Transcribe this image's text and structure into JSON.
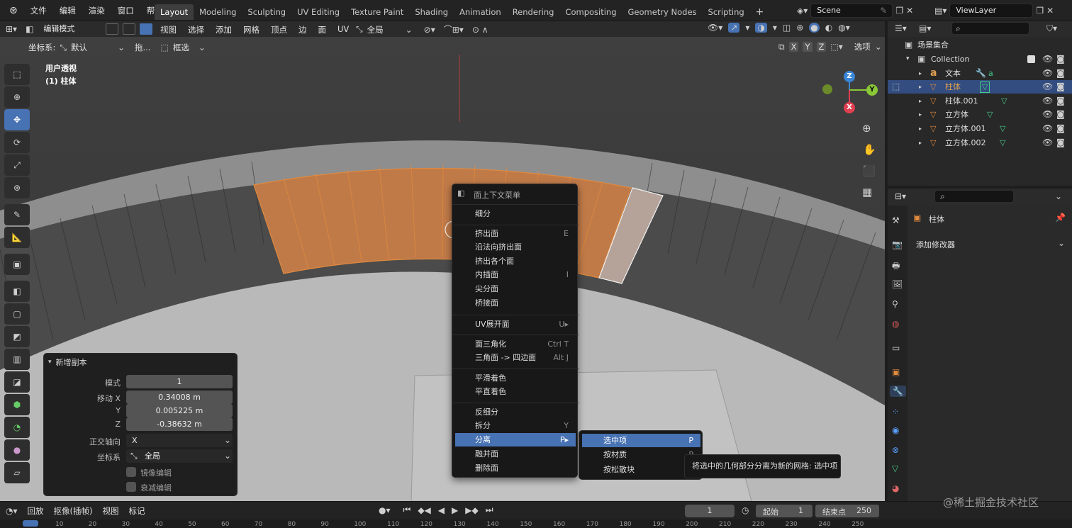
{
  "topbar": {
    "menus": [
      "文件",
      "编辑",
      "渲染",
      "窗口",
      "帮助"
    ],
    "workspaces": [
      "Layout",
      "Modeling",
      "Sculpting",
      "UV Editing",
      "Texture Paint",
      "Shading",
      "Animation",
      "Rendering",
      "Compositing",
      "Geometry Nodes",
      "Scripting"
    ],
    "active_workspace": "Layout",
    "add_icon": "+",
    "scene": "Scene",
    "view_layer": "ViewLayer"
  },
  "viewport_header": {
    "mode": "编辑模式",
    "menus": [
      "视图",
      "选择",
      "添加",
      "网格",
      "顶点",
      "边",
      "面",
      "UV"
    ],
    "transform_orientation": "全局",
    "coord_label": "坐标系:",
    "coord_value": "默认",
    "drag_label": "拖...",
    "drag_value": "框选",
    "axes": [
      "X",
      "Y",
      "Z"
    ],
    "options": "选项"
  },
  "viewport": {
    "view_name": "用户透视",
    "object_name": "(1) 柱体",
    "gizmo": {
      "x": "X",
      "y": "Y",
      "z": "Z"
    }
  },
  "redo_panel": {
    "title": "新增副本",
    "rows": [
      {
        "label": "模式",
        "value": "1"
      },
      {
        "label": "移动 X",
        "value": "0.34008 m"
      },
      {
        "label": "Y",
        "value": "0.005225 m"
      },
      {
        "label": "Z",
        "value": "-0.38632 m"
      },
      {
        "label": "正交轴向",
        "value": "X"
      },
      {
        "label": "坐标系",
        "value": "全局"
      }
    ],
    "checkboxes": [
      "镜像编辑",
      "衰减编辑"
    ]
  },
  "context_menu": {
    "title": "面上下文菜单",
    "groups": [
      [
        {
          "label": "细分",
          "shortcut": ""
        }
      ],
      [
        {
          "label": "挤出面",
          "shortcut": "E"
        },
        {
          "label": "沿法向挤出面",
          "shortcut": ""
        },
        {
          "label": "挤出各个面",
          "shortcut": ""
        },
        {
          "label": "内插面",
          "shortcut": "I"
        },
        {
          "label": "尖分面",
          "shortcut": ""
        },
        {
          "label": "桥接面",
          "shortcut": ""
        }
      ],
      [
        {
          "label": "UV展开面",
          "shortcut": "U▸"
        }
      ],
      [
        {
          "label": "面三角化",
          "shortcut": "Ctrl T"
        },
        {
          "label": "三角面 -> 四边面",
          "shortcut": "Alt J"
        }
      ],
      [
        {
          "label": "平滑着色",
          "shortcut": ""
        },
        {
          "label": "平直着色",
          "shortcut": ""
        }
      ],
      [
        {
          "label": "反细分",
          "shortcut": ""
        },
        {
          "label": "拆分",
          "shortcut": "Y"
        },
        {
          "label": "分离",
          "shortcut": "P▸"
        },
        {
          "label": "融并面",
          "shortcut": ""
        },
        {
          "label": "删除面",
          "shortcut": ""
        }
      ]
    ],
    "highlighted": "分离"
  },
  "submenu": {
    "items": [
      {
        "label": "选中项",
        "shortcut": "P"
      },
      {
        "label": "按材质",
        "shortcut": "P"
      },
      {
        "label": "按松散块",
        "shortcut": ""
      }
    ]
  },
  "tooltip": "将选中的几何部分分离为新的网格:  选中项",
  "outliner": {
    "root": "场景集合",
    "collection": "Collection",
    "objects": [
      {
        "name": "文本",
        "selected": false
      },
      {
        "name": "柱体",
        "selected": true
      },
      {
        "name": "柱体.001",
        "selected": false
      },
      {
        "name": "立方体",
        "selected": false
      },
      {
        "name": "立方体.001",
        "selected": false
      },
      {
        "name": "立方体.002",
        "selected": false
      }
    ]
  },
  "properties": {
    "object": "柱体",
    "add_modifier": "添加修改器"
  },
  "timeline": {
    "menus": [
      "回放",
      "抠像(插帧)",
      "视图",
      "标记"
    ],
    "current_frame": "1",
    "start_label": "起始",
    "start": "1",
    "end_label": "结束点",
    "end": "250",
    "ticks": [
      "0",
      "10",
      "20",
      "30",
      "40",
      "50",
      "60",
      "70",
      "80",
      "90",
      "100",
      "110",
      "120",
      "130",
      "140",
      "150",
      "160",
      "170",
      "180",
      "190",
      "200",
      "210",
      "220",
      "230",
      "240",
      "250"
    ]
  },
  "watermark": "@稀土掘金技术社区",
  "colors": {
    "accent": "#4772b3",
    "selection_orange": "#e08a3e",
    "x_axis": "#e04050",
    "y_axis": "#8ac838",
    "z_axis": "#3a86d6"
  }
}
